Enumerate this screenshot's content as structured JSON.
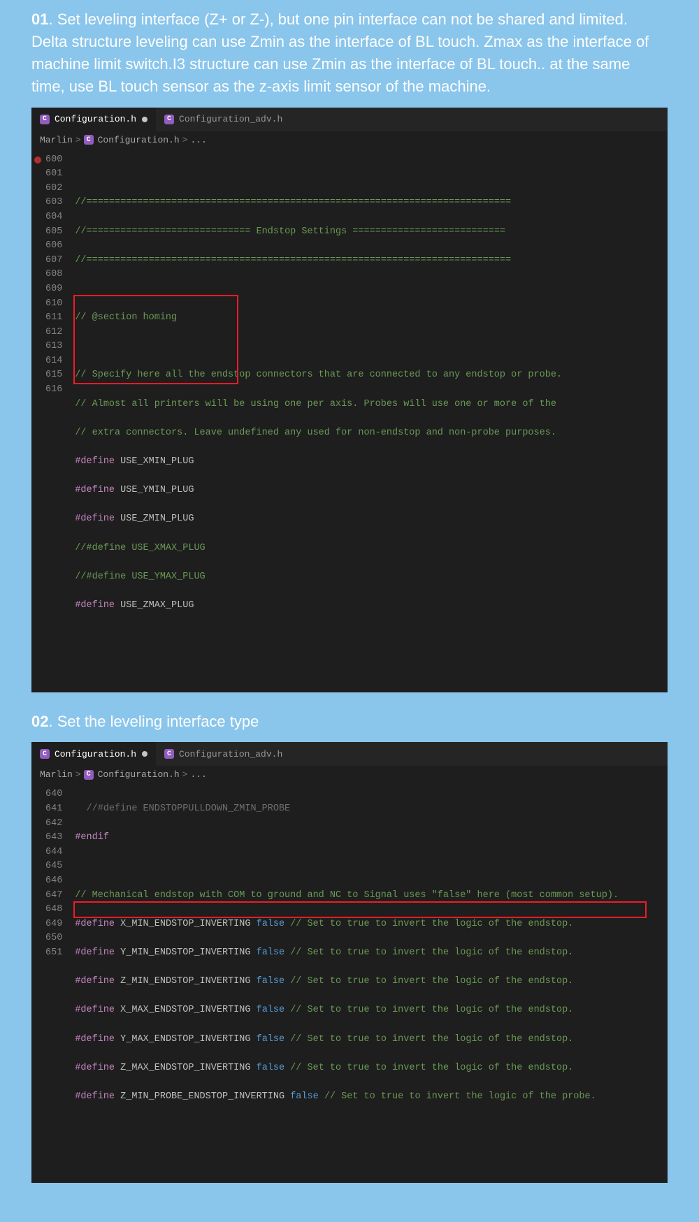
{
  "step1": {
    "num": "01",
    "dot": ".",
    "text": "Set leveling interface (Z+ or Z-),   but one pin interface can not be shared and limited. Delta structure leveling can use Zmin as the interface of BL touch. Zmax as the interface of machine limit switch.I3 structure can use Zmin as the interface of BL touch.. at the same time, use BL touch sensor as the z-axis limit sensor of the machine."
  },
  "step2": {
    "num": "02",
    "dot": ".",
    "text": "Set the leveling interface type"
  },
  "tabs": {
    "active": "Configuration.h",
    "inactive": "Configuration_adv.h",
    "icon": "C"
  },
  "breadcrumb": {
    "root": "Marlin",
    "file": "Configuration.h",
    "more": "...",
    "icon": "C",
    "sep": ">"
  },
  "code1": {
    "lines": [
      "600",
      "601",
      "602",
      "603",
      "604",
      "605",
      "606",
      "607",
      "608",
      "609",
      "610",
      "611",
      "612",
      "613",
      "614",
      "615",
      "616"
    ],
    "l601": "//===========================================================================",
    "l602a": "//============================= ",
    "l602b": "Endstop Settings",
    "l602c": " ===========================",
    "l603": "//===========================================================================",
    "l604": "",
    "l605": "// @section homing",
    "l606": "",
    "l607": "// Specify here all the endstop connectors that are connected to any endstop or probe.",
    "l608": "// Almost all printers will be using one per axis. Probes will use one or more of the",
    "l609": "// extra connectors. Leave undefined any used for non-endstop and non-probe purposes.",
    "define": "#define",
    "m610": "USE_XMIN_PLUG",
    "m611": "USE_YMIN_PLUG",
    "m612": "USE_ZMIN_PLUG",
    "l613": "//#define USE_XMAX_PLUG",
    "l614": "//#define USE_YMAX_PLUG",
    "m615": "USE_ZMAX_PLUG"
  },
  "code2": {
    "lines": [
      "640",
      "641",
      "642",
      "643",
      "644",
      "645",
      "646",
      "647",
      "648",
      "649",
      "650",
      "651"
    ],
    "l640": "//#define ENDSTOPPULLDOWN_ZMIN_PROBE",
    "define": "#define",
    "endif": "#endif",
    "l643": "// Mechanical endstop with COM to ground and NC to Signal uses \"false\" here (most common setup).",
    "false": "false",
    "m644": "X_MIN_ENDSTOP_INVERTING",
    "m645": "Y_MIN_ENDSTOP_INVERTING",
    "m646": "Z_MIN_ENDSTOP_INVERTING",
    "m647": "X_MAX_ENDSTOP_INVERTING",
    "m648": "Y_MAX_ENDSTOP_INVERTING",
    "m649": "Z_MAX_ENDSTOP_INVERTING",
    "m650": "Z_MIN_PROBE_ENDSTOP_INVERTING",
    "c_end": " // Set to true to invert the logic of the endstop.",
    "c_probe": " // Set to true to invert the logic of the probe."
  }
}
